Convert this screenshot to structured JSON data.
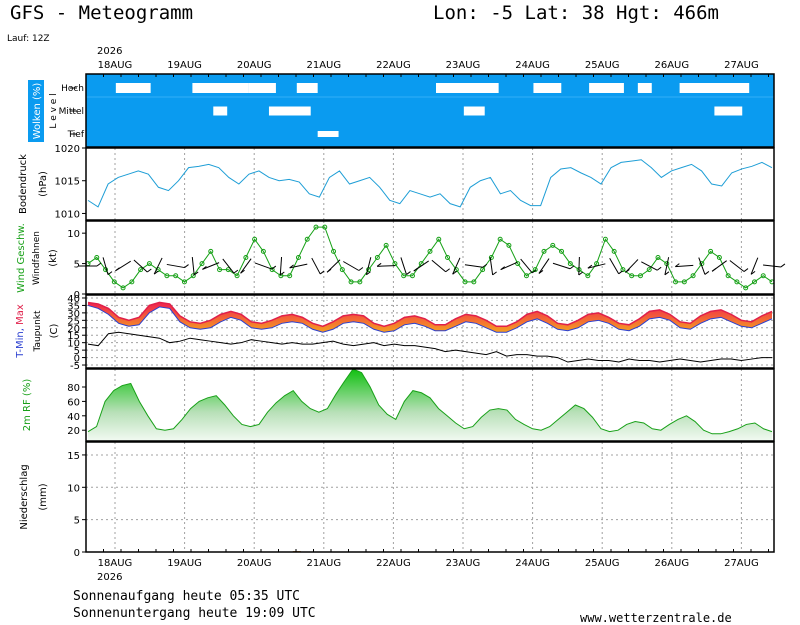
{
  "header": {
    "title": "GFS - Meteogramm",
    "location": "Lon: -5 Lat: 38 Hgt: 466m",
    "run": "Lauf: 12Z",
    "year": "2026"
  },
  "footer": {
    "sunrise": "Sonnenaufgang heute 05:35 UTC",
    "sunset": "Sonnenuntergang heute 19:09 UTC",
    "site": "www.wetterzentrale.de"
  },
  "colors": {
    "cloud_bg": "#0a9bf0",
    "pressure": "#1e9ed6",
    "wind": "#16a016",
    "temp_max": "#e0204a",
    "temp_min": "#2a3fd0",
    "temp_fill_hot": "#f02050",
    "temp_fill_warm": "#f5a020",
    "rh": "#18a018",
    "grid": "#a0a0a0"
  },
  "chart_data": [
    {
      "type": "heatmap",
      "name": "clouds",
      "ylabel": "Wolken (%)",
      "ylabel2": "L e v e l",
      "levels": [
        "Hoch",
        "Mittel",
        "Tief"
      ],
      "x": [
        "18AUG",
        "19AUG",
        "20AUG",
        "21AUG",
        "22AUG",
        "23AUG",
        "24AUG",
        "25AUG",
        "26AUG",
        "27AUG"
      ],
      "clouds": [
        {
          "level": "Hoch",
          "from": 0.4,
          "to": 0.9
        },
        {
          "level": "Hoch",
          "from": 1.5,
          "to": 2.3
        },
        {
          "level": "Hoch",
          "from": 2.3,
          "to": 2.7
        },
        {
          "level": "Hoch",
          "from": 3.0,
          "to": 3.3
        },
        {
          "level": "Hoch",
          "from": 5.0,
          "to": 5.9
        },
        {
          "level": "Hoch",
          "from": 6.4,
          "to": 6.8
        },
        {
          "level": "Hoch",
          "from": 7.2,
          "to": 7.7
        },
        {
          "level": "Hoch",
          "from": 7.9,
          "to": 8.1
        },
        {
          "level": "Hoch",
          "from": 8.5,
          "to": 9.5
        },
        {
          "level": "Mittel",
          "from": 1.8,
          "to": 2.0
        },
        {
          "level": "Mittel",
          "from": 2.6,
          "to": 3.2
        },
        {
          "level": "Mittel",
          "from": 5.4,
          "to": 5.7
        },
        {
          "level": "Mittel",
          "from": 9.0,
          "to": 9.4
        },
        {
          "level": "Tief",
          "from": 3.3,
          "to": 3.6
        }
      ]
    },
    {
      "type": "line",
      "name": "pressure",
      "ylabel": "Bodendruck",
      "ylabel2": "(hPa)",
      "ylim": [
        1009,
        1020
      ],
      "yticks": [
        1010,
        1015,
        1020
      ],
      "values": [
        1012,
        1011,
        1014.5,
        1015.5,
        1016,
        1016.5,
        1016,
        1014,
        1013.5,
        1015,
        1017,
        1017.2,
        1017.5,
        1017,
        1015.5,
        1014.5,
        1016,
        1016.5,
        1015.5,
        1015,
        1015.2,
        1014.8,
        1013,
        1012.5,
        1015.5,
        1016.5,
        1014.5,
        1015,
        1015.5,
        1014,
        1012,
        1011.5,
        1013.5,
        1013,
        1012.5,
        1013,
        1011.5,
        1011,
        1014,
        1015,
        1015.5,
        1013,
        1013.5,
        1012,
        1011.2,
        1011.2,
        1015.5,
        1016.8,
        1017,
        1016.2,
        1015.5,
        1014.5,
        1017,
        1017.8,
        1018,
        1018.2,
        1017,
        1015.5,
        1016.5,
        1017,
        1017.5,
        1016.5,
        1014.5,
        1014.2,
        1016.2,
        1016.8,
        1017.2,
        1017.8,
        1017
      ]
    },
    {
      "type": "line",
      "name": "wind",
      "ylabel": "Wind Geschw.",
      "ylabel2": "Windfahnen",
      "ylabel3": "(kt)",
      "ylim": [
        0,
        12
      ],
      "yticks": [
        0,
        5,
        10
      ],
      "values": [
        5,
        6,
        4,
        2,
        1,
        2,
        4,
        5,
        4,
        3,
        3,
        2,
        3,
        5,
        7,
        4,
        4,
        3,
        6,
        9,
        7,
        4,
        3,
        3,
        6,
        9,
        11,
        11,
        7,
        4,
        2,
        2,
        4,
        6,
        8,
        5,
        3,
        3,
        5,
        7,
        9,
        6,
        4,
        2,
        2,
        4,
        6,
        9,
        8,
        5,
        3,
        4,
        7,
        8,
        7,
        5,
        4,
        3,
        5,
        9,
        7,
        4,
        3,
        3,
        4,
        6,
        5,
        2,
        2,
        3,
        5,
        7,
        6,
        3,
        2,
        1,
        2,
        3,
        2
      ]
    },
    {
      "type": "area",
      "name": "temperature",
      "ylabel": "T-Min, Max",
      "ylabel2": "Taupunkt",
      "ylabel3": "(C)",
      "ylim": [
        -7,
        42
      ],
      "yticks": [
        -5,
        0,
        5,
        10,
        15,
        20,
        25,
        30,
        35,
        40
      ],
      "series": [
        {
          "name": "Max",
          "values": [
            37,
            36,
            33,
            27,
            25,
            27,
            35,
            37,
            36,
            28,
            24,
            23,
            25,
            29,
            31,
            29,
            24,
            23,
            25,
            28,
            29,
            27,
            23,
            21,
            24,
            28,
            29,
            28,
            23,
            21,
            23,
            27,
            28,
            26,
            22,
            22,
            26,
            29,
            28,
            25,
            21,
            21,
            24,
            29,
            31,
            28,
            23,
            22,
            25,
            29,
            30,
            27,
            23,
            22,
            26,
            31,
            32,
            29,
            24,
            23,
            28,
            31,
            32,
            29,
            25,
            24,
            28,
            31
          ]
        },
        {
          "name": "Min",
          "values": [
            35,
            33,
            29,
            23,
            21,
            22,
            30,
            34,
            33,
            24,
            20,
            19,
            20,
            24,
            27,
            25,
            20,
            19,
            20,
            23,
            24,
            23,
            19,
            17,
            19,
            23,
            24,
            23,
            19,
            17,
            18,
            22,
            23,
            21,
            18,
            18,
            21,
            24,
            23,
            20,
            17,
            17,
            20,
            24,
            26,
            23,
            19,
            18,
            20,
            24,
            25,
            23,
            19,
            18,
            21,
            26,
            27,
            25,
            20,
            19,
            23,
            26,
            27,
            24,
            21,
            20,
            23,
            26
          ]
        },
        {
          "name": "Taupunkt",
          "values": [
            9,
            8,
            16,
            17,
            16,
            15,
            14,
            13,
            10,
            11,
            13,
            12,
            11,
            10,
            9,
            10,
            12,
            11,
            10,
            9,
            10,
            9,
            9,
            10,
            11,
            9,
            8,
            9,
            10,
            8,
            9,
            8,
            8,
            7,
            6,
            4,
            5,
            4,
            3,
            2,
            4,
            1,
            2,
            2,
            1,
            1,
            0,
            -3,
            -2,
            -1,
            -2,
            -2,
            -3,
            -1,
            -2,
            -2,
            -3,
            -2,
            -1,
            -2,
            -3,
            -2,
            -1,
            -1,
            -2,
            -1,
            0,
            0
          ]
        }
      ]
    },
    {
      "type": "area",
      "name": "humidity",
      "ylabel": "2m RF (%)",
      "ylim": [
        5,
        105
      ],
      "yticks": [
        20,
        40,
        60,
        80
      ],
      "values": [
        18,
        25,
        60,
        75,
        82,
        85,
        60,
        40,
        22,
        20,
        22,
        35,
        50,
        60,
        65,
        68,
        55,
        40,
        28,
        25,
        28,
        45,
        58,
        68,
        75,
        60,
        50,
        45,
        50,
        70,
        88,
        105,
        100,
        80,
        55,
        42,
        35,
        60,
        75,
        72,
        65,
        50,
        40,
        30,
        22,
        25,
        38,
        48,
        50,
        48,
        35,
        28,
        22,
        20,
        25,
        35,
        45,
        55,
        50,
        38,
        22,
        18,
        20,
        28,
        32,
        30,
        22,
        20,
        28,
        35,
        40,
        32,
        20,
        15,
        15,
        18,
        22,
        28,
        30,
        22,
        18
      ]
    },
    {
      "type": "bar",
      "name": "precipitation",
      "ylabel": "Niederschlag",
      "ylabel2": "(mm)",
      "ylim": [
        0,
        17
      ],
      "yticks": [
        0,
        5,
        10,
        15
      ],
      "values": [
        {
          "x": 3.0,
          "v": 0.15
        }
      ]
    }
  ],
  "axes": {
    "x_labels": [
      "18AUG",
      "19AUG",
      "20AUG",
      "21AUG",
      "22AUG",
      "23AUG",
      "24AUG",
      "25AUG",
      "26AUG",
      "27AUG"
    ],
    "x_first_year": "2026"
  }
}
